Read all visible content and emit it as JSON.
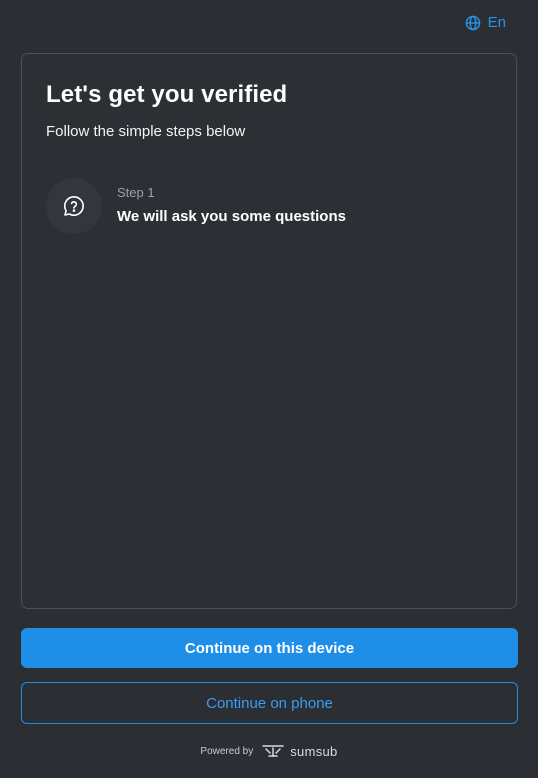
{
  "language": {
    "icon": "globe-icon",
    "label": "En"
  },
  "card": {
    "title": "Let's get you verified",
    "subtitle": "Follow the simple steps below",
    "steps": [
      {
        "icon": "question-chat-icon",
        "label": "Step 1",
        "description": "We will ask you some questions"
      }
    ]
  },
  "actions": {
    "primary_label": "Continue on this device",
    "secondary_label": "Continue on phone"
  },
  "footer": {
    "powered_by": "Powered by",
    "brand": "sumsub",
    "brand_icon": "sumsub-logo-icon"
  },
  "colors": {
    "background": "#2b2e33",
    "accent": "#1e8ee9",
    "card_border": "#4c5057"
  }
}
